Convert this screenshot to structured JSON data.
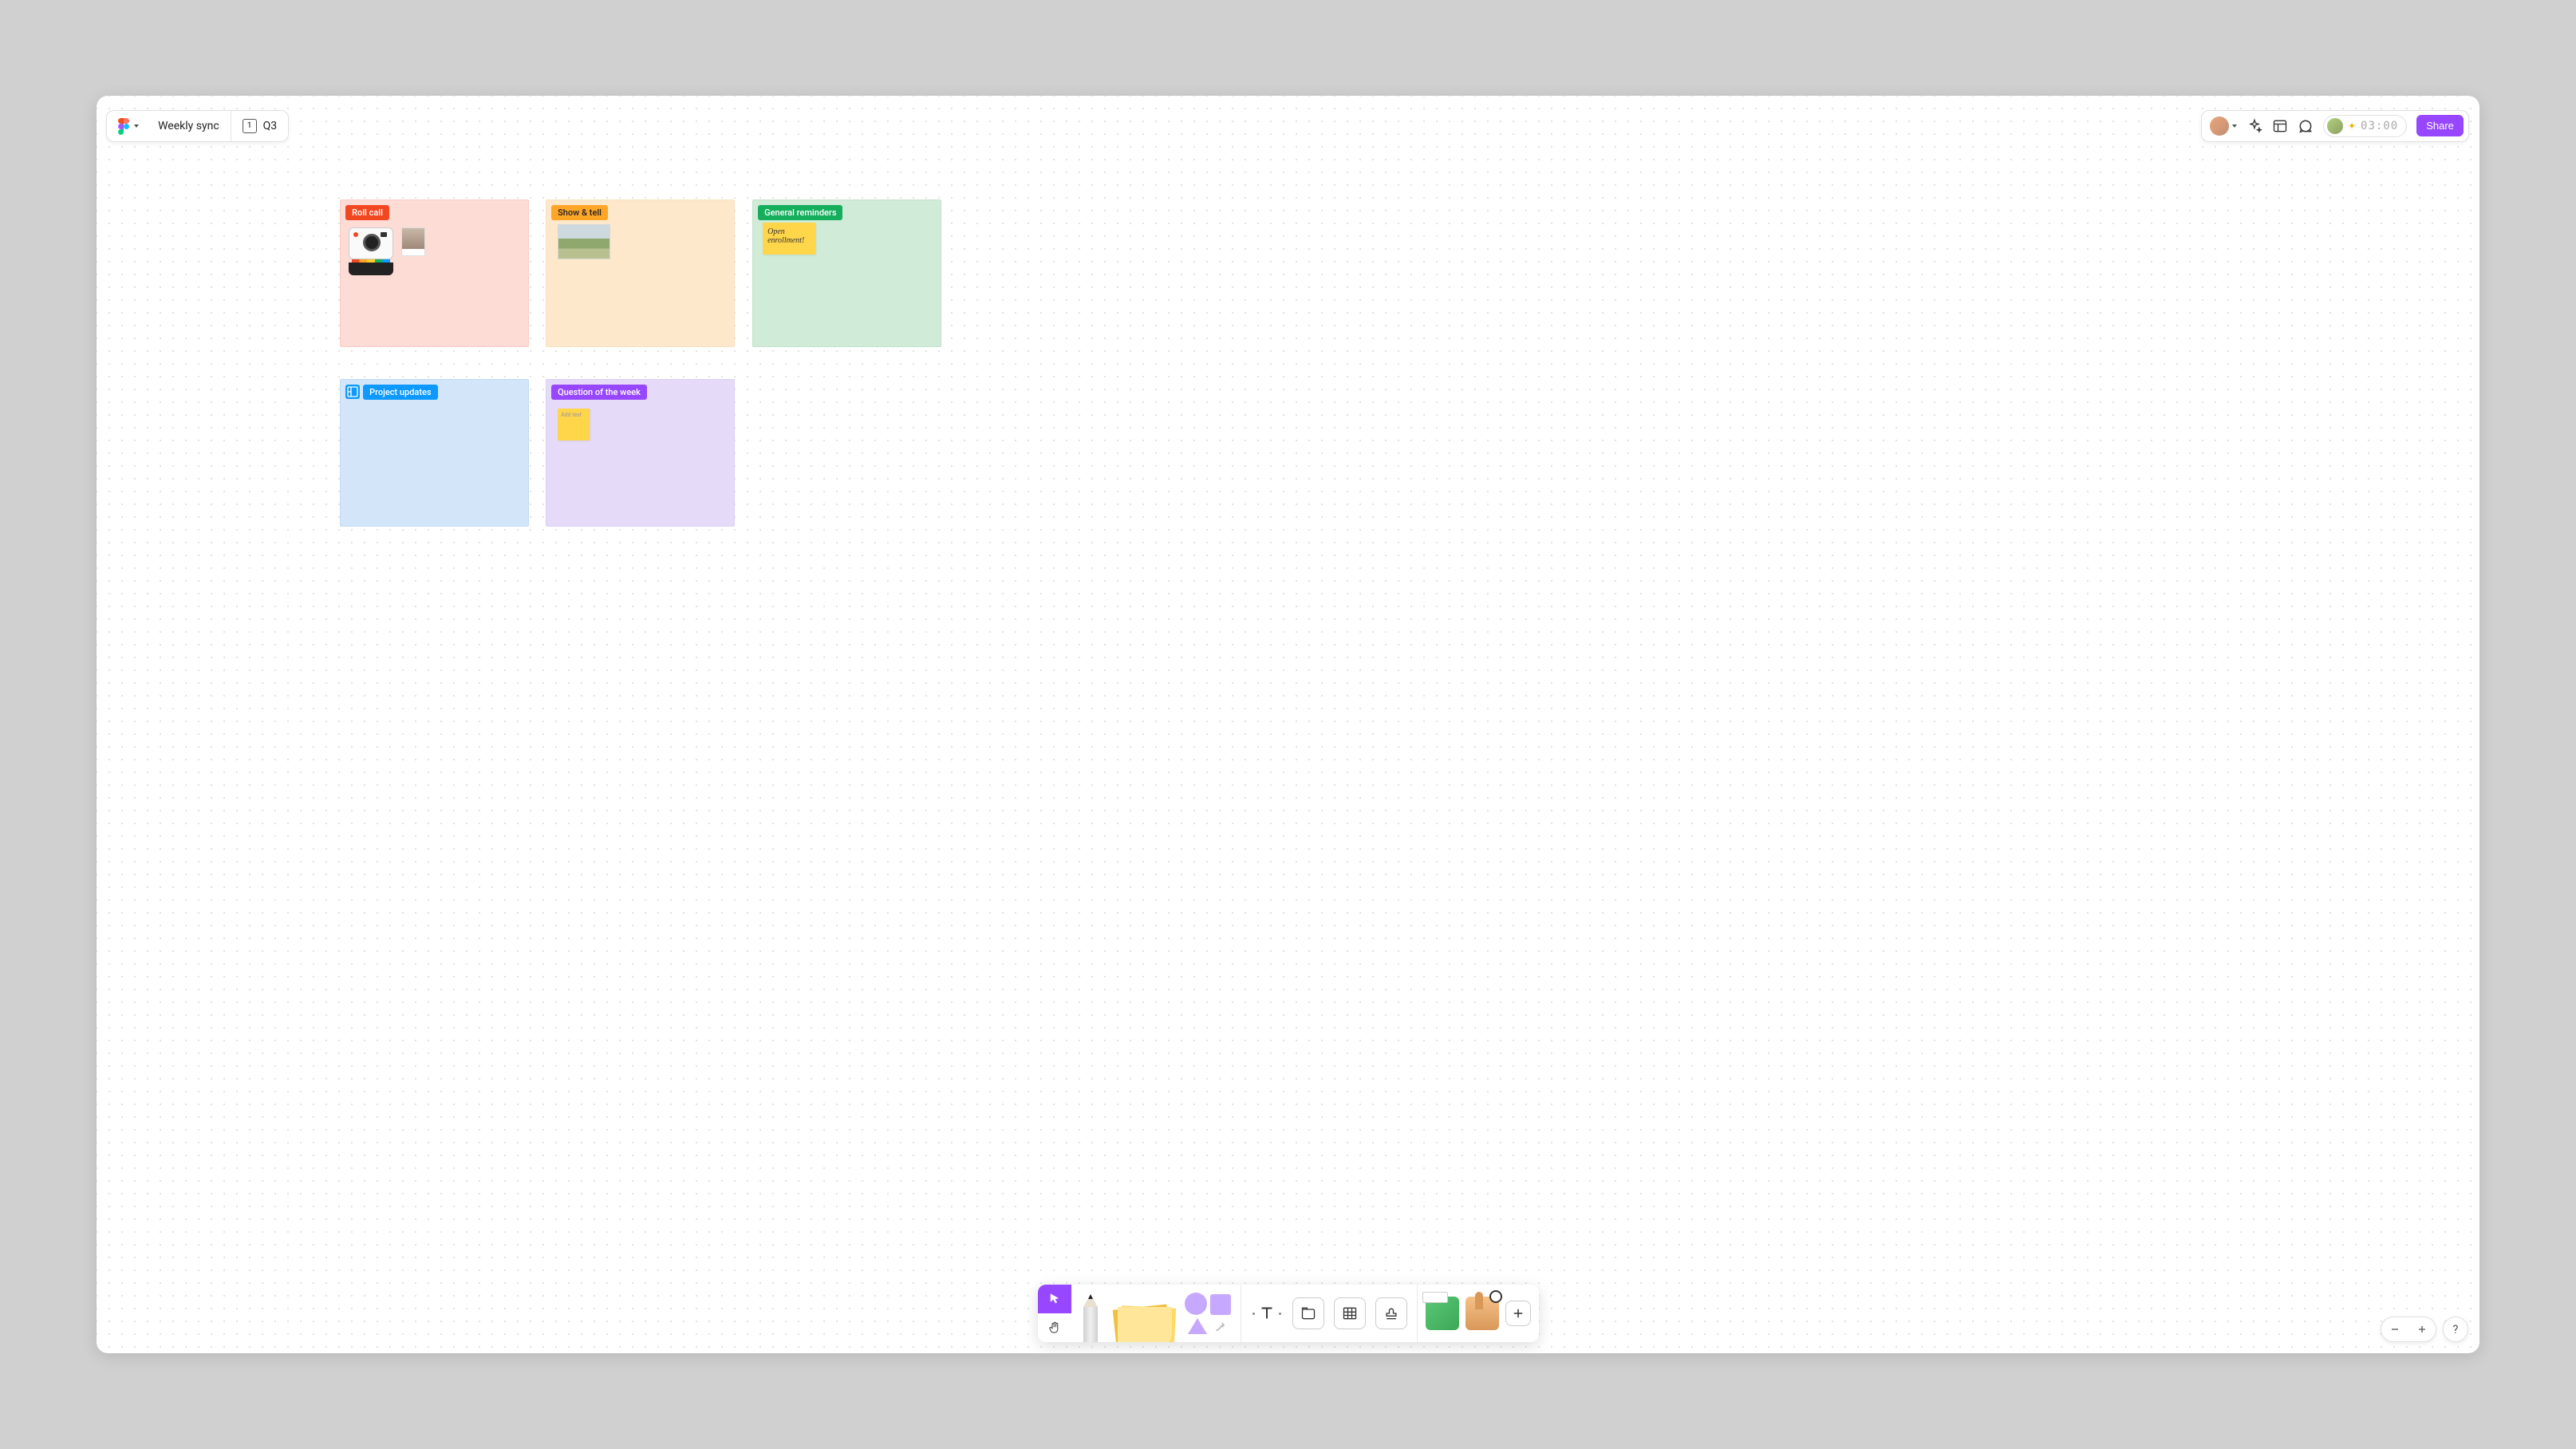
{
  "header": {
    "file_title": "Weekly sync",
    "page_number": "1",
    "page_label": "Q3"
  },
  "top_right": {
    "timer": "03:00",
    "share_label": "Share"
  },
  "sections": {
    "s1": {
      "label": "Roll call"
    },
    "s2": {
      "label": "Show & tell"
    },
    "s3": {
      "label": "General reminders",
      "sticky_text": "Open enrollment!"
    },
    "s4": {
      "label": "Project updates"
    },
    "s5": {
      "label": "Question of the week",
      "sticky_placeholder": "Add text"
    }
  },
  "zoom": {
    "help": "?"
  }
}
